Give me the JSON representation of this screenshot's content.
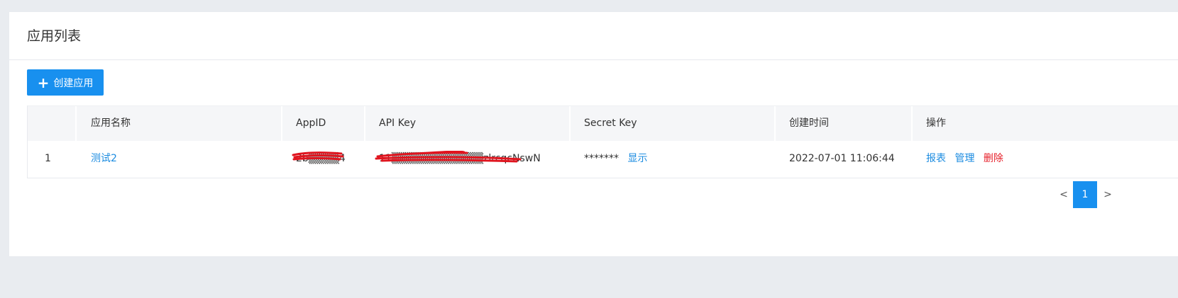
{
  "page": {
    "title": "应用列表",
    "create_button": "创建应用",
    "create_icon": "plus-icon"
  },
  "table": {
    "columns": [
      "",
      "应用名称",
      "AppID",
      "API Key",
      "Secret Key",
      "创建时间",
      "操作"
    ],
    "rows": [
      {
        "index": "1",
        "name": "测试2",
        "app_id": "2b▒▒▒▒4",
        "api_key": "11▒▒▒▒▒▒▒▒▒▒▒▒zlrcqcNswN",
        "secret_key": "*******",
        "secret_show": "显示",
        "created": "2022-07-01 11:06:44",
        "actions": {
          "report": "报表",
          "manage": "管理",
          "delete": "删除"
        }
      }
    ]
  },
  "pagination": {
    "prev": "<",
    "current": "1",
    "next": ">"
  },
  "colors": {
    "primary": "#1890ef",
    "link": "#1a8be0",
    "danger": "#e6202a",
    "redaction": "#e0141e"
  }
}
